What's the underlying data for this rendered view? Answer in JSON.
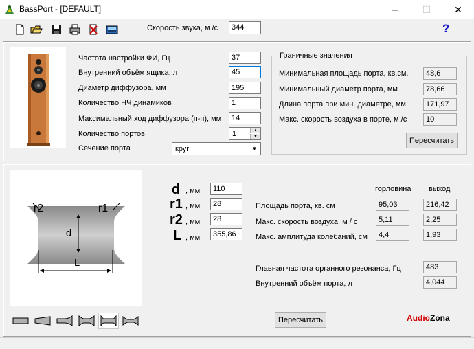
{
  "window": {
    "title": "BassPort - [DEFAULT]",
    "minimize": "─",
    "maximize": "☐",
    "close": "✕"
  },
  "toolbar": {
    "icons": [
      "new-file-icon",
      "open-folder-icon",
      "save-disk-icon",
      "print-icon",
      "delete-icon",
      "calculator-icon"
    ],
    "sound_speed_label": "Скорость звука, м /с",
    "sound_speed_value": "344",
    "help": "?"
  },
  "params": {
    "rows": [
      {
        "label": "Частота настройки ФИ, Гц",
        "value": "37"
      },
      {
        "label": "Внутренний объём ящика, л",
        "value": "45"
      },
      {
        "label": "Диаметр диффузора, мм",
        "value": "195"
      },
      {
        "label": "Количество НЧ динамиков",
        "value": "1"
      },
      {
        "label": "Максимальный ход диффузора (п-п), мм",
        "value": "14"
      }
    ],
    "ports_count_label": "Количество портов",
    "ports_count_value": "1",
    "port_section_label": "Сечение порта",
    "port_section_value": "круг"
  },
  "limits": {
    "title": "Граничные значения",
    "rows": [
      {
        "label": "Минимальная площадь порта, кв.см.",
        "value": "48,6"
      },
      {
        "label": "Минимальный диаметр порта, мм",
        "value": "78,66"
      },
      {
        "label": "Длина порта при мин. диаметре, мм",
        "value": "171,97"
      },
      {
        "label": "Макс. скорость воздуха в порте, м /с",
        "value": "10"
      }
    ],
    "recalc": "Пересчитать"
  },
  "dims": {
    "rows": [
      {
        "symbol": "d",
        "unit": ", мм",
        "value": "110"
      },
      {
        "symbol": "r1",
        "unit": ", мм",
        "value": "28"
      },
      {
        "symbol": "r2",
        "unit": ", мм",
        "value": "28"
      },
      {
        "symbol": "L",
        "unit": ", мм",
        "value": "355,86"
      }
    ]
  },
  "diagram": {
    "r2": "r2",
    "r1": "r1",
    "d": "d",
    "L": "L"
  },
  "results": {
    "col_throat": "горловина",
    "col_exit": "выход",
    "rows": [
      {
        "label": "Площадь порта, кв. см",
        "throat": "95,03",
        "exit": "216,42"
      },
      {
        "label": "Макс. скорость воздуха, м / с",
        "throat": "5,11",
        "exit": "2,25"
      },
      {
        "label": "Макс. амплитуда колебаний, см",
        "throat": "4,4",
        "exit": "1,93"
      }
    ],
    "resonance_label": "Главная частота органного резонанса, Гц",
    "resonance_value": "483",
    "port_volume_label": "Внутренний объём порта, л",
    "port_volume_value": "4,044",
    "recalc": "Пересчитать"
  },
  "shapes": [
    "straight-tube-icon",
    "cone-icon",
    "horn-icon",
    "double-flare-icon",
    "flared-both-ends-icon",
    "flared-rounded-icon"
  ],
  "brand": {
    "a": "Audio",
    "b": "Zona"
  }
}
